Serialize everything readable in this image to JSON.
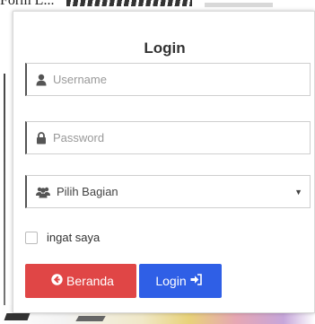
{
  "background": {
    "top_text": "Form L..."
  },
  "login_panel": {
    "title": "Login",
    "username_placeholder": "Username",
    "password_placeholder": "Password",
    "role_select": {
      "selected": "Pilih Bagian"
    },
    "remember_label": "ingat saya",
    "home_button_label": "Beranda",
    "login_button_label": "Login"
  },
  "colors": {
    "home_button": "#e04646",
    "login_button": "#2f5fe6"
  },
  "icons": {
    "username": "user-icon",
    "password": "lock-icon",
    "role": "users-icon",
    "home": "arrow-circle-left-icon",
    "login": "sign-in-icon"
  }
}
